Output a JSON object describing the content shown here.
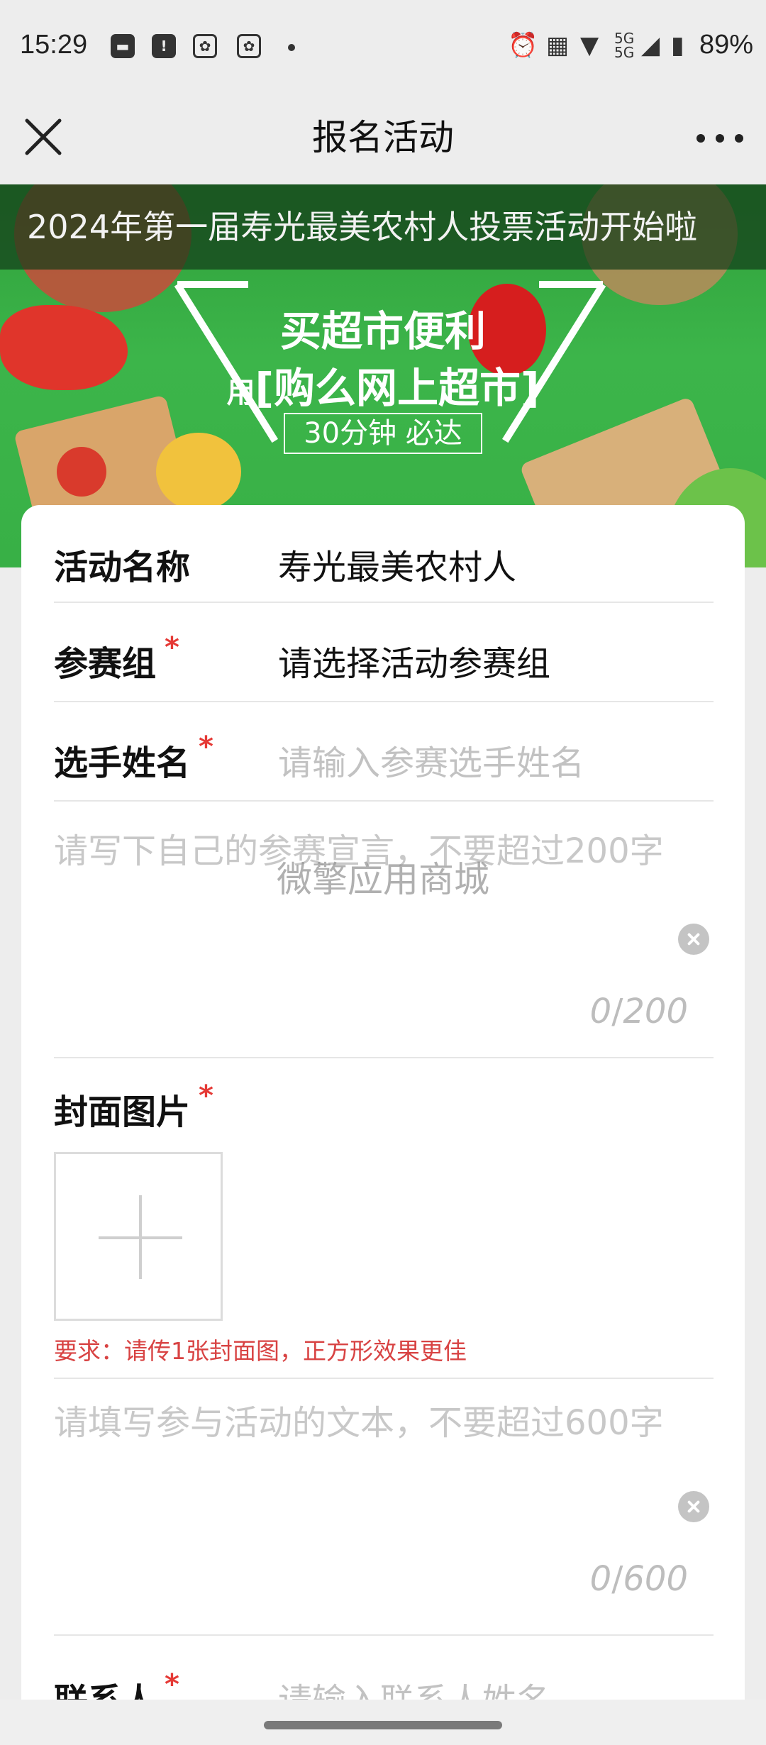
{
  "status_bar": {
    "time": "15:29",
    "icons_left": [
      "message-icon",
      "alert-icon",
      "paw-app-icon",
      "paw-app-icon"
    ],
    "icons_right": [
      "alarm-icon",
      "nfc-icon",
      "wifi-icon",
      "5g-signal-icon",
      "battery-icon"
    ],
    "battery": "89%"
  },
  "title_bar": {
    "title": "报名活动",
    "close_icon": "close-icon",
    "more_icon": "more-icon"
  },
  "banner": {
    "ticker": "2024年第一届寿光最美农村人投票活动开始啦",
    "headline": "买超市便利",
    "sub_prefix": "用",
    "sub_main": "[购么网上超市]",
    "badge": "30分钟 必达"
  },
  "form": {
    "activity_name": {
      "label": "活动名称",
      "value": "寿光最美农村人"
    },
    "group": {
      "label": "参赛组",
      "required": "*",
      "value": "请选择活动参赛组"
    },
    "player_name": {
      "label": "选手姓名",
      "required": "*",
      "placeholder": "请输入参赛选手姓名"
    },
    "declaration": {
      "placeholder": "请写下自己的参赛宣言，不要超过200字",
      "count": "0",
      "max": "200"
    },
    "cover": {
      "label": "封面图片",
      "required": "*",
      "hint": "要求：请传1张封面图，正方形效果更佳"
    },
    "text": {
      "placeholder": "请填写参与活动的文本，不要超过600字",
      "count": "0",
      "max": "600"
    },
    "contact": {
      "label": "联系人",
      "required": "*",
      "placeholder": "请输入联系人姓名"
    }
  },
  "watermark": "微擎应用商城",
  "colors": {
    "banner_green": "#3cb54a",
    "required_red": "#e53935",
    "hint_red": "#d84343"
  }
}
